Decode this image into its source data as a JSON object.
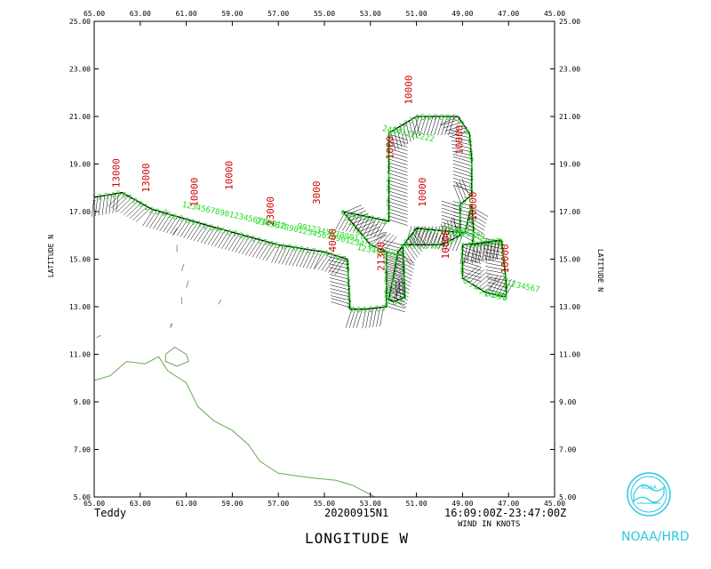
{
  "chart_data": {
    "type": "scatter",
    "xlabel": "LONGITUDE   W",
    "ylabel_left": "LATITUDE   N",
    "ylabel_right": "LATITUDE   N",
    "xlim": [
      65,
      45
    ],
    "ylim": [
      5,
      25
    ],
    "x_ticks": [
      "65.00",
      "63.00",
      "61.00",
      "59.00",
      "57.00",
      "55.00",
      "53.00",
      "51.00",
      "49.00",
      "47.00",
      "45.00"
    ],
    "y_ticks": [
      "25.00",
      "23.00",
      "21.00",
      "19.00",
      "17.00",
      "15.00",
      "13.00",
      "11.00",
      "9.00",
      "7.00",
      "5.00"
    ],
    "grid": false,
    "colors": {
      "track": "#000000",
      "wind_labels": "#22dd22",
      "altitude_labels": "#cc0000",
      "coast": "#66aa55",
      "logo": "#27c8e0"
    },
    "flight_track": {
      "lon": [
        65.0,
        63.8,
        62.5,
        60.0,
        57.0,
        55.0,
        54.0,
        53.9,
        53.9,
        53.2,
        52.3,
        52.3,
        53.0,
        54.2,
        52.2,
        52.2,
        51.0,
        49.2,
        48.7,
        48.6,
        48.6,
        49.1,
        49.1,
        49.9,
        51.6,
        51.5,
        52.0,
        52.2,
        51.8,
        51.0,
        48.9,
        48.6,
        48.5,
        48.6,
        47.3,
        47.1,
        47.1,
        48.0,
        49.0,
        49.0,
        47.3
      ],
      "lat": [
        17.6,
        17.8,
        17.1,
        16.4,
        15.6,
        15.3,
        15.0,
        13.2,
        12.9,
        12.9,
        13.0,
        15.3,
        15.6,
        17.0,
        16.6,
        20.3,
        21.0,
        21.0,
        20.3,
        19.2,
        17.7,
        17.3,
        16.0,
        15.6,
        15.6,
        13.4,
        13.2,
        13.3,
        15.3,
        16.3,
        16.1,
        17.3,
        16.0,
        15.6,
        15.8,
        14.0,
        13.4,
        13.6,
        14.2,
        15.6,
        15.8
      ]
    },
    "altitude_labels": [
      {
        "text": "13000",
        "lon": 63.9,
        "lat": 18.0
      },
      {
        "text": "13000",
        "lon": 62.6,
        "lat": 17.8
      },
      {
        "text": "10000",
        "lon": 60.5,
        "lat": 17.2
      },
      {
        "text": "10000",
        "lon": 59.0,
        "lat": 17.9
      },
      {
        "text": "23000",
        "lon": 57.2,
        "lat": 16.4
      },
      {
        "text": "3000",
        "lon": 55.2,
        "lat": 17.3
      },
      {
        "text": "4000",
        "lon": 54.5,
        "lat": 15.3
      },
      {
        "text": "21300",
        "lon": 52.4,
        "lat": 14.5
      },
      {
        "text": "1000",
        "lon": 52.0,
        "lat": 19.2
      },
      {
        "text": "10000",
        "lon": 51.2,
        "lat": 21.5
      },
      {
        "text": "10000",
        "lon": 50.6,
        "lat": 17.2
      },
      {
        "text": "10000",
        "lon": 49.0,
        "lat": 19.4
      },
      {
        "text": "10000",
        "lon": 48.4,
        "lat": 16.6
      },
      {
        "text": "10000",
        "lon": 49.6,
        "lat": 15.0
      },
      {
        "text": "10000",
        "lon": 47.0,
        "lat": 14.4
      }
    ],
    "wind_label_groups": [
      {
        "text": "1234567890123456789012",
        "lon": 61.2,
        "lat": 17.2
      },
      {
        "text": "23456789012345678901234",
        "lon": 58.0,
        "lat": 16.5
      },
      {
        "text": "9012345678901",
        "lon": 56.2,
        "lat": 16.3
      },
      {
        "text": "12345678",
        "lon": 53.6,
        "lat": 15.4
      },
      {
        "text": "24141222222",
        "lon": 52.5,
        "lat": 20.4
      },
      {
        "text": "123456789",
        "lon": 49.9,
        "lat": 16.2
      },
      {
        "text": "1234567",
        "lon": 47.1,
        "lat": 13.9
      },
      {
        "text": "12345",
        "lon": 48.1,
        "lat": 13.5
      }
    ]
  },
  "footer": {
    "storm_name": "Teddy",
    "flight_id": "20200915N1",
    "time_range": "16:09:00Z-23:47:00Z",
    "wind_units": "WIND IN KNOTS",
    "agency": "NOAA/HRD"
  }
}
